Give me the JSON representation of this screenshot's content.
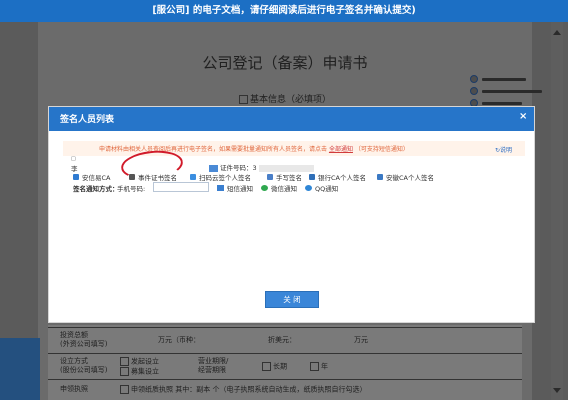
{
  "top_banner": {
    "text": "[服公司] 的电子文档，请仔细阅读后进行电子签名并确认提交)"
  },
  "document": {
    "title": "公司登记（备案）申请书",
    "section_basic": "基本信息（必填项）",
    "lower_rows": [
      {
        "label": "投资总额\n(外资公司填写)",
        "field1": "万元（币种：",
        "field2": "折美元：",
        "field3": "万元"
      },
      {
        "label": "设立方式\n(股份公司填写)",
        "opt1": "发起设立",
        "opt2": "募集设立",
        "label2": "营业期限/\n经营期限",
        "opt3": "长期",
        "opt4": "年"
      },
      {
        "label": "申领执照",
        "text": "申领纸质执照  其中：副本  个（电子执照系统自动生成，纸质执照自行勾选）"
      }
    ]
  },
  "modal": {
    "title": "签名人员列表",
    "close_symbol": "×",
    "notice_prefix": "申请材料由相关人员查阅后再进行电子签名，如果需要批量通知所有人员签名，请点击",
    "notice_link": "全部通知",
    "notice_suffix": "（可支持短信通知）",
    "help_label": "说明",
    "hint": "□",
    "signer": "李",
    "cert_label": "证件号码：3",
    "sign_options": [
      {
        "label": "安信易CA",
        "color": "#2f7bd1"
      },
      {
        "label": "事件证书签名",
        "color": "#555555"
      },
      {
        "label": "扫码云签个人签名",
        "color": "#3b8ee0"
      },
      {
        "label": "手写签名",
        "color": "#4a7fc8"
      },
      {
        "label": "银行CA个人签名",
        "color": "#2f6fb8"
      },
      {
        "label": "安徽CA个人签名",
        "color": "#3a79c4"
      }
    ],
    "notify_label": "签名通知方式：",
    "phone_label": "手机号码:",
    "phone_value": "",
    "notify_options": [
      {
        "label": "短信通知",
        "color": "#3a7fd0"
      },
      {
        "label": "微信通知",
        "color": "#2fa84f"
      },
      {
        "label": "QQ通知",
        "color": "#2f86d6"
      }
    ],
    "close_button": "关 闭"
  }
}
